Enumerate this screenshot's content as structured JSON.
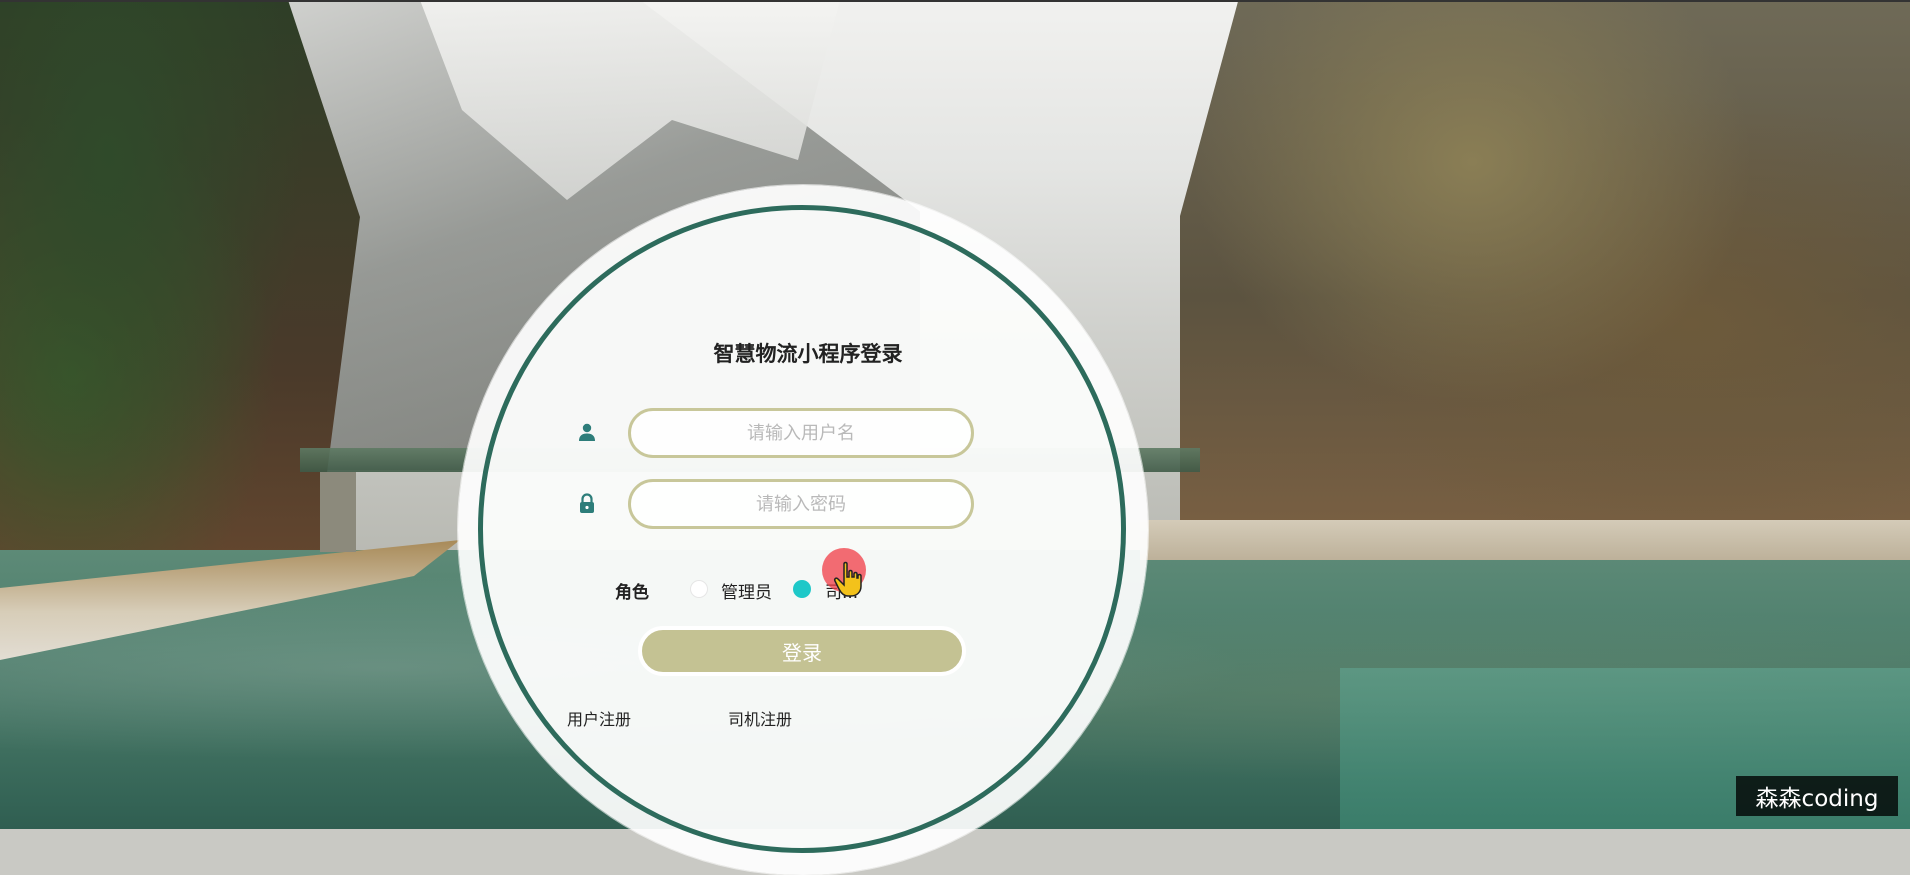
{
  "login": {
    "title": "智慧物流小程序登录",
    "username_placeholder": "请输入用户名",
    "password_placeholder": "请输入密码",
    "role_label": "角色",
    "roles": [
      {
        "label": "管理员",
        "selected": false
      },
      {
        "label": "司...",
        "selected": true
      }
    ],
    "login_button": "登录",
    "user_register": "用户注册",
    "driver_register": "司机注册"
  },
  "icons": {
    "user": "user-icon",
    "lock": "lock-icon",
    "cursor": "hand-pointer-icon"
  },
  "colors": {
    "ring": "#2d6b5c",
    "input_border": "#c8c79a",
    "button": "#c4c293",
    "radio_selected": "#1ec8c8",
    "icon": "#2d7d7a"
  },
  "watermark": "森森coding"
}
